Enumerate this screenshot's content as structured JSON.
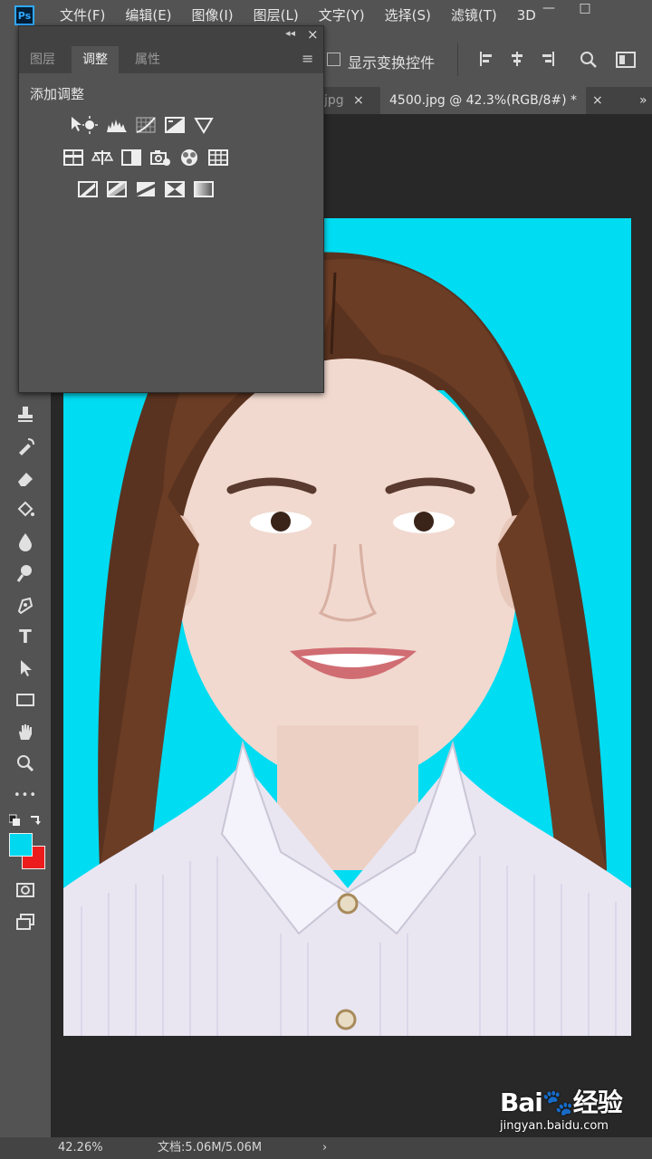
{
  "app": {
    "logo": "Ps"
  },
  "menu": [
    "文件(F)",
    "编辑(E)",
    "图像(I)",
    "图层(L)",
    "文字(Y)",
    "选择(S)",
    "滤镜(T)",
    "3D"
  ],
  "window_controls": {
    "minimize": "—",
    "maximize": "□"
  },
  "options_bar": {
    "show_transform_controls": "显示变换控件",
    "checked": false
  },
  "document_tabs": [
    {
      "label": "jpg",
      "active": false
    },
    {
      "label": "4500.jpg @ 42.3%(RGB/8#) *",
      "active": true
    }
  ],
  "tab_close": "×",
  "tab_overflow": "»",
  "adjustments_panel": {
    "collapse": "◂◂",
    "close": "×",
    "menu": "≡",
    "tabs": [
      {
        "label": "图层",
        "active": false
      },
      {
        "label": "调整",
        "active": true
      },
      {
        "label": "属性",
        "active": false
      }
    ],
    "title": "添加调整",
    "icons_row1": [
      "brightness-contrast-icon",
      "levels-icon",
      "curves-icon",
      "exposure-icon",
      "vibrance-icon"
    ],
    "icons_row2": [
      "hue-saturation-icon",
      "color-balance-icon",
      "black-white-icon",
      "photo-filter-icon",
      "channel-mixer-icon",
      "color-lookup-icon"
    ],
    "icons_row3": [
      "invert-icon",
      "posterize-icon",
      "threshold-icon",
      "selective-color-icon",
      "gradient-map-icon"
    ]
  },
  "tools": [
    "stamp-tool",
    "history-brush-tool",
    "eraser-tool",
    "paint-bucket-tool",
    "blur-tool",
    "dodge-tool",
    "pen-tool",
    "type-tool",
    "path-selection-tool",
    "rectangle-tool",
    "hand-tool",
    "zoom-tool",
    "more-tools",
    "swap-colors",
    "foreground-background-colors",
    "quick-mask",
    "screen-mode"
  ],
  "type_tool_glyph": "T",
  "more_tools_glyph": "•••",
  "colors": {
    "foreground": "#00d8f0",
    "background": "#ec1c1c",
    "photo_background": "#00dcf2"
  },
  "status_bar": {
    "zoom": "42.26%",
    "doc_info": "文档:5.06M/5.06M",
    "arrow": "›"
  },
  "watermark": {
    "logo": "Bai🐾经验",
    "url": "jingyan.baidu.com"
  }
}
